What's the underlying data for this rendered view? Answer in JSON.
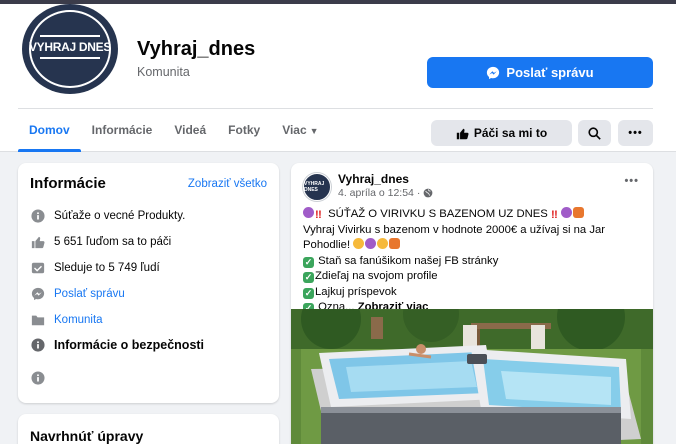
{
  "page": {
    "logo_text": "VYHRAJ DNES",
    "name": "Vyhraj_dnes",
    "category": "Komunita",
    "send_message_label": "Poslať správu"
  },
  "tabs": [
    {
      "label": "Domov",
      "active": true
    },
    {
      "label": "Informácie"
    },
    {
      "label": "Videá"
    },
    {
      "label": "Fotky"
    },
    {
      "label": "Viac",
      "has_caret": true
    }
  ],
  "actions": {
    "like_label": "Páči sa mi to",
    "search_icon": "search-icon",
    "more_icon": "more-icon"
  },
  "info": {
    "title": "Informácie",
    "see_all": "Zobraziť všetko",
    "rows": [
      {
        "icon": "info-icon",
        "text": "Súťaže o vecné Produkty."
      },
      {
        "icon": "thumbs-up-icon",
        "text": "5 651 ľuďom sa to páči"
      },
      {
        "icon": "follow-icon",
        "text": "Sleduje to 5 749 ľudí"
      },
      {
        "icon": "messenger-icon",
        "text": "Poslať správu"
      },
      {
        "icon": "folder-icon",
        "text": "Komunita"
      },
      {
        "icon": "info-icon",
        "text": "Informácie o bezpečnosti"
      }
    ]
  },
  "suggest": {
    "title": "Navrhnúť úpravy"
  },
  "post": {
    "author": "Vyhraj_dnes",
    "date": "4. apríla o 12:54",
    "separator": "·",
    "line1": "SÚŤAŽ O VIRIVKU S BAZENOM UZ DNES",
    "line2": "Vyhraj Vivirku s bazenom v hodnote 2000€ a užívaj si na Jar",
    "line3": "Pohodlie!",
    "line4": "Staň sa fanúšikom našej FB stránky",
    "line5": "Zdieľaj na svojom profile",
    "line6": "Lajkuj príspevok",
    "line7": "Ozna...",
    "see_more": "Zobraziť viac"
  },
  "colors": {
    "brand_blue": "#1877f2",
    "logo_navy": "#26344f"
  }
}
